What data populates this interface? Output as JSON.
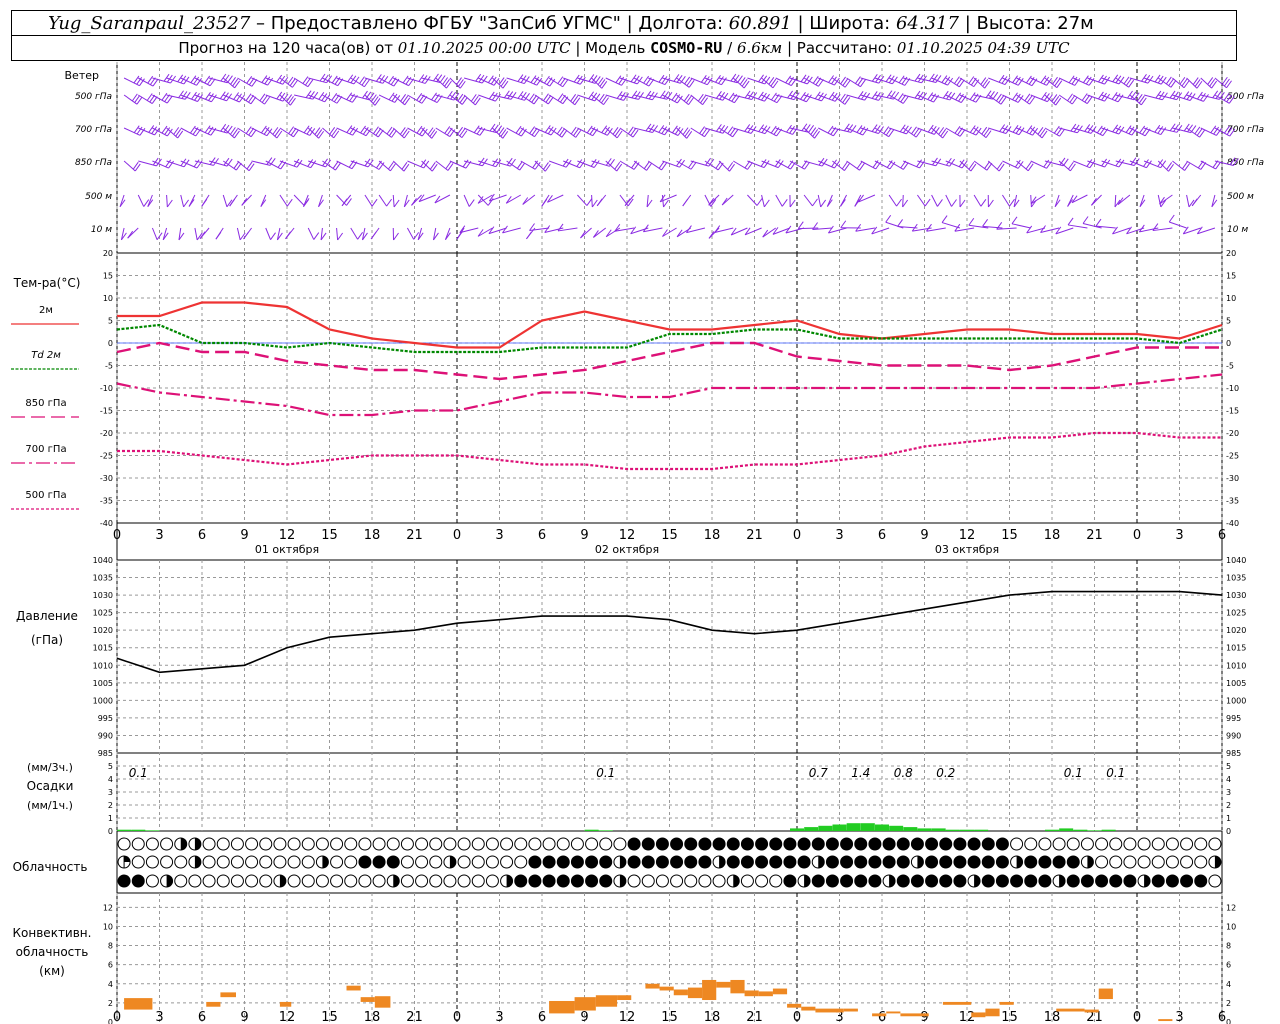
{
  "header": {
    "station": "Yug_Saranpaul_23527",
    "provider": "Предоставлено ФГБУ \"ЗапСиб УГМС\"",
    "lon_label": "Долгота:",
    "lon": "60.891",
    "lat_label": "Широта:",
    "lat": "64.317",
    "alt_label": "Высота:",
    "alt": "27м",
    "forecast_prefix": "Прогноз на 120 часа(ов) от",
    "forecast_time": "01.10.2025 00:00 UTC",
    "model_label": "Модель",
    "model": "COSMO-RU",
    "resolution": "6.6км",
    "computed_label": "Рассчитано:",
    "computed_time": "01.10.2025 04:39 UTC"
  },
  "wind_panel": {
    "label": "Ветер",
    "levels": [
      "500 гПа",
      "700 гПа",
      "850 гПа",
      "500 м",
      "10 м"
    ],
    "color": "#8a2be2"
  },
  "temp_panel": {
    "title": "Тем-ра(°C)",
    "legend": [
      "2м",
      "Td 2м",
      "850 гПа",
      "700 гПа",
      "500 гПа"
    ]
  },
  "time_axis": {
    "ticks": [
      "0",
      "3",
      "6",
      "9",
      "12",
      "15",
      "18",
      "21",
      "0",
      "3",
      "6",
      "9",
      "12",
      "15",
      "18",
      "21",
      "0",
      "3",
      "6",
      "9",
      "12",
      "15",
      "18",
      "21",
      "0",
      "3",
      "6"
    ],
    "days": [
      "01 октября",
      "02 октября",
      "03 октября"
    ]
  },
  "pressure_panel": {
    "label1": "Давление",
    "label2": "(гПа)"
  },
  "precip_panel": {
    "label1": "(мм/3ч.)",
    "label2": "Осадки",
    "label3": "(мм/1ч.)",
    "values": [
      {
        "hour": 1.5,
        "value": "0.1"
      },
      {
        "hour": 34.5,
        "value": "0.1"
      },
      {
        "hour": 49.5,
        "value": "0.7"
      },
      {
        "hour": 52.5,
        "value": "1.4"
      },
      {
        "hour": 55.5,
        "value": "0.8"
      },
      {
        "hour": 58.5,
        "value": "0.2"
      },
      {
        "hour": 67.5,
        "value": "0.1"
      },
      {
        "hour": 70.5,
        "value": "0.1"
      }
    ]
  },
  "cloud_panel": {
    "label": "Облачность"
  },
  "conv_panel": {
    "label1": "Конвективн.",
    "label2": "облачность",
    "label3": "(км)"
  },
  "colors": {
    "t2m": "#ee3333",
    "td2m": "#008800",
    "t850": "#dd1177",
    "t700": "#dd1177",
    "t500": "#dd1177",
    "pressure": "#000000",
    "precip": "#22cc22",
    "conv": "#ee8822"
  },
  "chart_data": [
    {
      "type": "line",
      "title": "Тем-ра(°C)",
      "xlabel": "",
      "ylabel": "Тем-ра(°C)",
      "ylim": [
        -40,
        20
      ],
      "x_hours": [
        0,
        3,
        6,
        9,
        12,
        15,
        18,
        21,
        24,
        27,
        30,
        33,
        36,
        39,
        42,
        45,
        48,
        51,
        54,
        57,
        60,
        63,
        66,
        69,
        72,
        75,
        78
      ],
      "series": [
        {
          "name": "2м",
          "values": [
            6,
            6,
            9,
            9,
            8,
            3,
            1,
            0,
            -1,
            -1,
            5,
            7,
            5,
            3,
            3,
            4,
            5,
            2,
            1,
            2,
            3,
            3,
            2,
            2,
            2,
            1,
            4
          ]
        },
        {
          "name": "Td 2м",
          "values": [
            3,
            4,
            0,
            0,
            -1,
            0,
            -1,
            -2,
            -2,
            -2,
            -1,
            -1,
            -1,
            2,
            2,
            3,
            3,
            1,
            1,
            1,
            1,
            1,
            1,
            1,
            1,
            0,
            3
          ]
        },
        {
          "name": "850 гПа",
          "values": [
            -2,
            0,
            -2,
            -2,
            -4,
            -5,
            -6,
            -6,
            -7,
            -8,
            -7,
            -6,
            -4,
            -2,
            0,
            0,
            -3,
            -4,
            -5,
            -5,
            -5,
            -6,
            -5,
            -3,
            -1,
            -1,
            -1
          ]
        },
        {
          "name": "700 гПа",
          "values": [
            -9,
            -11,
            -12,
            -13,
            -14,
            -16,
            -16,
            -15,
            -15,
            -13,
            -11,
            -11,
            -12,
            -12,
            -10,
            -10,
            -10,
            -10,
            -10,
            -10,
            -10,
            -10,
            -10,
            -10,
            -9,
            -8,
            -7
          ]
        },
        {
          "name": "500 гПа",
          "values": [
            -24,
            -24,
            -25,
            -26,
            -27,
            -26,
            -25,
            -25,
            -25,
            -26,
            -27,
            -27,
            -28,
            -28,
            -28,
            -27,
            -27,
            -26,
            -25,
            -23,
            -22,
            -21,
            -21,
            -20,
            -20,
            -21,
            -21
          ]
        }
      ]
    },
    {
      "type": "line",
      "title": "Давление",
      "xlabel": "",
      "ylabel": "(гПа)",
      "ylim": [
        985,
        1040
      ],
      "x_hours": [
        0,
        3,
        6,
        9,
        12,
        15,
        18,
        21,
        24,
        27,
        30,
        33,
        36,
        39,
        42,
        45,
        48,
        51,
        54,
        57,
        60,
        63,
        66,
        69,
        72,
        75,
        78
      ],
      "series": [
        {
          "name": "Давление",
          "values": [
            1012,
            1008,
            1009,
            1010,
            1015,
            1018,
            1019,
            1020,
            1022,
            1023,
            1024,
            1024,
            1024,
            1023,
            1020,
            1019,
            1020,
            1022,
            1024,
            1026,
            1028,
            1030,
            1031,
            1031,
            1031,
            1031,
            1030
          ]
        }
      ]
    },
    {
      "type": "bar",
      "title": "Осадки",
      "xlabel": "",
      "ylabel": "(мм/1ч.)",
      "ylim": [
        0,
        5
      ],
      "x_hours": [
        0.5,
        1.5,
        2.5,
        33.5,
        34.5,
        48,
        49,
        50,
        51,
        52,
        53,
        54,
        55,
        56,
        57,
        58,
        59,
        60,
        61,
        66,
        67,
        68,
        69,
        70
      ],
      "values": [
        0.1,
        0.1,
        0.05,
        0.1,
        0.05,
        0.2,
        0.3,
        0.4,
        0.5,
        0.6,
        0.6,
        0.5,
        0.4,
        0.3,
        0.2,
        0.2,
        0.1,
        0.1,
        0.1,
        0.1,
        0.2,
        0.1,
        0.05,
        0.1
      ]
    },
    {
      "type": "bar",
      "title": "Конвективн. облачность",
      "xlabel": "",
      "ylabel": "(км)",
      "ylim": [
        0,
        13
      ],
      "segments": [
        {
          "h0": 0.5,
          "h1": 2.5,
          "base": 1.3,
          "top": 2.5
        },
        {
          "h0": 6.3,
          "h1": 7.3,
          "base": 1.6,
          "top": 2.1
        },
        {
          "h0": 7.3,
          "h1": 8.4,
          "base": 2.6,
          "top": 3.1
        },
        {
          "h0": 11.5,
          "h1": 12.3,
          "base": 1.6,
          "top": 2.1
        },
        {
          "h0": 16.2,
          "h1": 17.2,
          "base": 3.3,
          "top": 3.8
        },
        {
          "h0": 17.2,
          "h1": 18.2,
          "base": 2.1,
          "top": 2.6
        },
        {
          "h0": 18.2,
          "h1": 19.3,
          "base": 1.5,
          "top": 2.7
        },
        {
          "h0": 30.5,
          "h1": 32.3,
          "base": 0.9,
          "top": 2.2
        },
        {
          "h0": 32.3,
          "h1": 33.8,
          "base": 1.2,
          "top": 2.6
        },
        {
          "h0": 33.8,
          "h1": 35.3,
          "base": 1.6,
          "top": 2.8
        },
        {
          "h0": 35.3,
          "h1": 36.3,
          "base": 2.3,
          "top": 2.8
        },
        {
          "h0": 37.3,
          "h1": 38.3,
          "base": 3.5,
          "top": 4.0
        },
        {
          "h0": 38.3,
          "h1": 39.3,
          "base": 3.3,
          "top": 3.7
        },
        {
          "h0": 39.3,
          "h1": 40.3,
          "base": 2.8,
          "top": 3.4
        },
        {
          "h0": 40.3,
          "h1": 41.3,
          "base": 2.5,
          "top": 3.6
        },
        {
          "h0": 41.3,
          "h1": 42.3,
          "base": 2.3,
          "top": 4.4
        },
        {
          "h0": 42.3,
          "h1": 43.3,
          "base": 3.6,
          "top": 4.2
        },
        {
          "h0": 43.3,
          "h1": 44.3,
          "base": 3.0,
          "top": 4.4
        },
        {
          "h0": 44.3,
          "h1": 45.3,
          "base": 2.7,
          "top": 3.3
        },
        {
          "h0": 45.3,
          "h1": 46.3,
          "base": 2.7,
          "top": 3.2
        },
        {
          "h0": 46.3,
          "h1": 47.3,
          "base": 2.9,
          "top": 3.5
        },
        {
          "h0": 47.3,
          "h1": 48.3,
          "base": 1.5,
          "top": 1.9
        },
        {
          "h0": 48.3,
          "h1": 49.3,
          "base": 1.2,
          "top": 1.6
        },
        {
          "h0": 49.3,
          "h1": 51.3,
          "base": 1.0,
          "top": 1.4
        },
        {
          "h0": 51.3,
          "h1": 52.3,
          "base": 1.1,
          "top": 1.4
        },
        {
          "h0": 53.3,
          "h1": 54.3,
          "base": 0.6,
          "top": 0.9
        },
        {
          "h0": 54.3,
          "h1": 55.3,
          "base": 0.9,
          "top": 1.1
        },
        {
          "h0": 55.3,
          "h1": 57.3,
          "base": 0.6,
          "top": 0.9
        },
        {
          "h0": 58.3,
          "h1": 60.3,
          "base": 1.8,
          "top": 2.1
        },
        {
          "h0": 60.3,
          "h1": 61.3,
          "base": 0.5,
          "top": 1.0
        },
        {
          "h0": 61.3,
          "h1": 62.3,
          "base": 0.6,
          "top": 1.4
        },
        {
          "h0": 62.3,
          "h1": 63.3,
          "base": 1.8,
          "top": 2.1
        },
        {
          "h0": 66.3,
          "h1": 68.3,
          "base": 1.1,
          "top": 1.4
        },
        {
          "h0": 68.3,
          "h1": 69.3,
          "base": 1.0,
          "top": 1.3
        },
        {
          "h0": 69.3,
          "h1": 70.3,
          "base": 2.4,
          "top": 3.5
        },
        {
          "h0": 73.5,
          "h1": 74.5,
          "base": 0.1,
          "top": 0.3
        }
      ]
    }
  ]
}
